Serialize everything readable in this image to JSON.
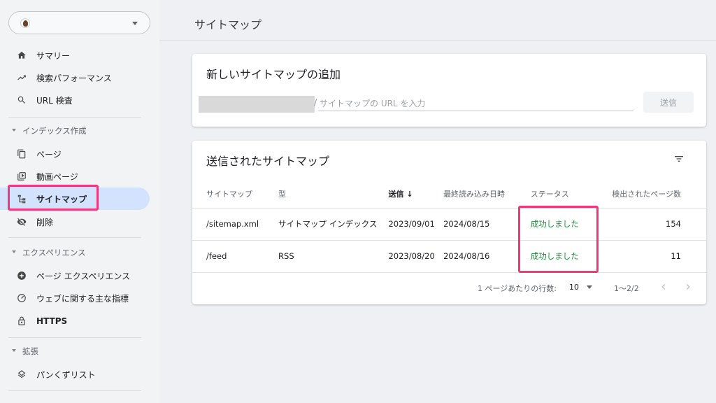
{
  "sidebar": {
    "property_selector": "",
    "items_top": [
      {
        "label": "サマリー",
        "icon": "home-icon"
      },
      {
        "label": "検索パフォーマンス",
        "icon": "trending-up-icon"
      },
      {
        "label": "URL 検査",
        "icon": "search-icon"
      }
    ],
    "section_indexing": "インデックス作成",
    "items_indexing": [
      {
        "label": "ページ",
        "icon": "pages-icon"
      },
      {
        "label": "動画ページ",
        "icon": "video-pages-icon"
      },
      {
        "label": "サイトマップ",
        "icon": "sitemap-icon"
      },
      {
        "label": "削除",
        "icon": "visibility-off-icon"
      }
    ],
    "section_experience": "エクスペリエンス",
    "items_experience": [
      {
        "label": "ページ エクスペリエンス",
        "icon": "page-experience-icon"
      },
      {
        "label": "ウェブに関する主な指標",
        "icon": "speed-icon"
      },
      {
        "label": "HTTPS",
        "icon": "lock-icon"
      }
    ],
    "section_enhancements": "拡張",
    "items_enhancements": [
      {
        "label": "パンくずリスト",
        "icon": "layers-icon"
      }
    ],
    "active_item": "サイトマップ"
  },
  "header": {
    "title": "サイトマップ"
  },
  "add_sitemap": {
    "title": "新しいサイトマップの追加",
    "url_placeholder": "サイトマップの URL を入力",
    "submit_label": "送信"
  },
  "submitted": {
    "title": "送信されたサイトマップ",
    "columns": [
      "サイトマップ",
      "型",
      "送信",
      "最終読み込み日時",
      "ステータス",
      "検出されたページ数"
    ],
    "sort_indicator": "↓",
    "rows": [
      {
        "sitemap": "/sitemap.xml",
        "type": "サイトマップ インデックス",
        "submitted": "2023/09/01",
        "last_read": "2024/08/15",
        "status": "成功しました",
        "pages": "154"
      },
      {
        "sitemap": "/feed",
        "type": "RSS",
        "submitted": "2023/08/20",
        "last_read": "2024/08/16",
        "status": "成功しました",
        "pages": "11"
      }
    ],
    "pager": {
      "rows_per_page_label": "1 ページあたりの行数:",
      "rows_per_page_value": "10",
      "range": "1〜2/2"
    }
  },
  "colors": {
    "accent_active_bg": "#d3e3fd",
    "status_success": "#1e8e3e",
    "highlight": "#f0377a"
  }
}
